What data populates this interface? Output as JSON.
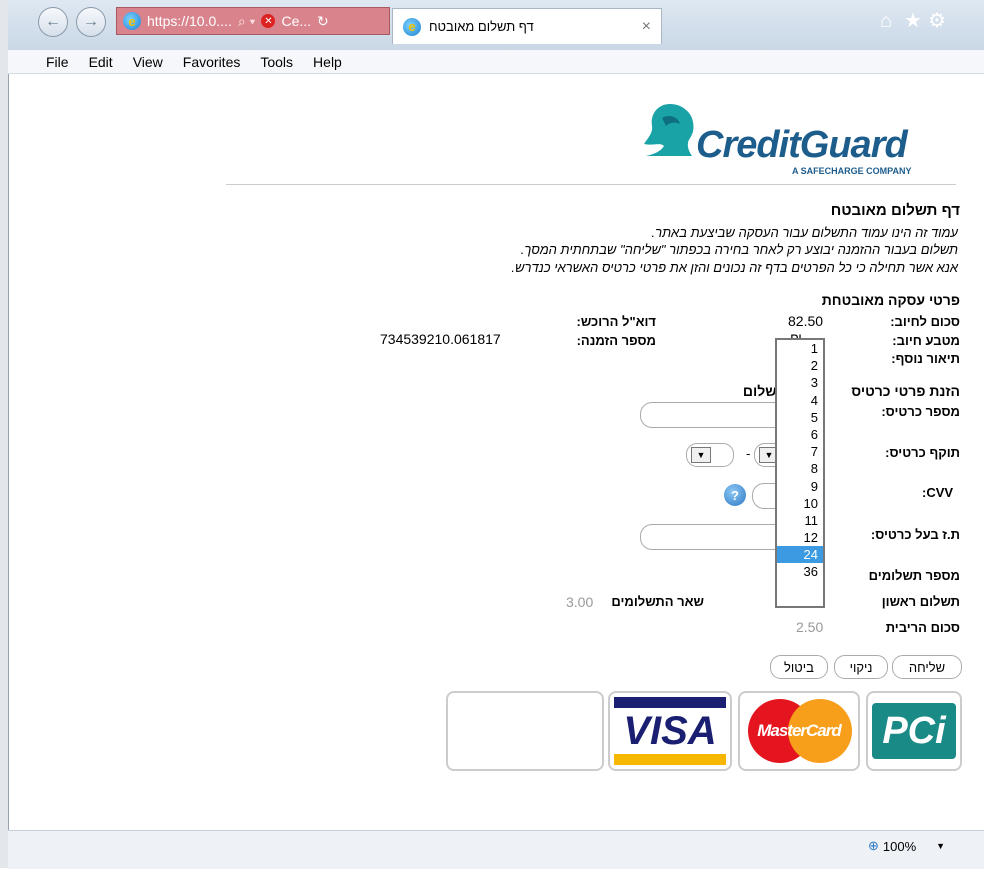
{
  "browser": {
    "address_text": "https://10.0....",
    "address_search": "⌕ ▾",
    "cert_label": "Ce...",
    "tab_title": "דף תשלום מאובטח",
    "tab_close": "×",
    "menu": [
      "File",
      "Edit",
      "View",
      "Favorites",
      "Tools",
      "Help"
    ],
    "zoom": "100%",
    "zoom_icon": "⊕",
    "zoom_arrow": "▼"
  },
  "logo": {
    "name": "CreditGuard",
    "tagline": "A SAFECHARGE COMPANY"
  },
  "page": {
    "title": "דף תשלום מאובטח",
    "intro_lines": [
      "עמוד זה הינו עמוד התשלום עבור העסקה שביצעת באתר.",
      "תשלום בעבור ההזמנה יבוצע רק לאחר בחירה בכפתור \"שליחה\" שבתחתית המסך.",
      "אנא אשר תחילה כי כל הפרטים בדף זה נכונים והזן את פרטי כרטיס האשראי כנדרש."
    ],
    "transaction_heading": "פרטי עסקה מאובטחת",
    "amount_label": "סכום לחיוב:",
    "amount_value": "82.50",
    "currency_label": "מטבע חיוב:",
    "currency_value_partial": "₪",
    "extra_label": "תיאור נוסף:",
    "buyer_email_label": "דוא\"ל הרוכש:",
    "order_number_label": "מספר הזמנה:",
    "order_number_value": "734539210.061817",
    "card_heading_right": "הזנת פרטי כרטיס",
    "card_heading_left": "לתשלום",
    "card_number_label": "מספר כרטיס:",
    "card_expiry_label": "תוקף כרטיס:",
    "expiry_sep": "-",
    "cvv_label": ":CVV",
    "help_icon_text": "?",
    "id_label": "ת.ז בעל כרטיס:",
    "payments_label": "מספר תשלומים",
    "first_payment_label": "תשלום ראשון",
    "rest_payments_label": "שאר התשלומים",
    "rest_payments_value": "3.00",
    "interest_label": "סכום הריבית",
    "interest_value": "2.50",
    "buttons": {
      "send": "שליחה",
      "clear": "ניקוי",
      "cancel": "ביטול"
    },
    "dropdown_options": [
      "1",
      "2",
      "3",
      "4",
      "5",
      "6",
      "7",
      "8",
      "9",
      "10",
      "11",
      "12",
      "24",
      "36"
    ],
    "dropdown_selected": "24",
    "cards": {
      "pci": "PCi",
      "mastercard": "MasterCard",
      "visa": "VISA"
    }
  },
  "colors": {
    "brand": "#1d5d8c",
    "brand_teal": "#1aa3a6",
    "selection": "#3b9ae1",
    "address_bar": "#d9848c"
  }
}
